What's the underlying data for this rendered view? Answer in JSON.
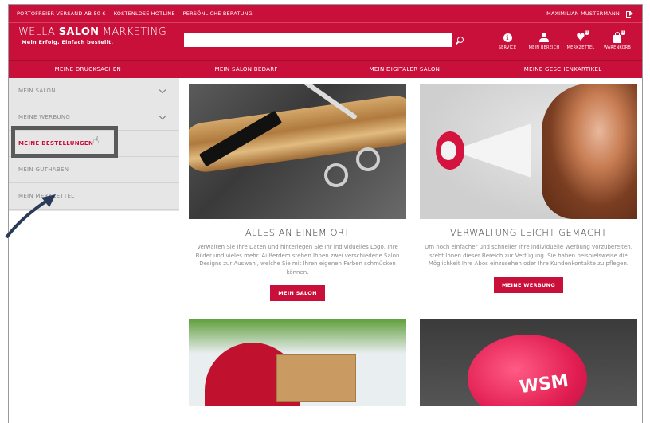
{
  "topbar": {
    "links": [
      "PORTOFREIER VERSAND AB 50 €",
      "KOSTENLOSE HOTLINE",
      "PERSÖNLICHE BERATUNG"
    ],
    "user": "MAXIMILIAN MUSTERMANN"
  },
  "header": {
    "logo_part1": "WELLA ",
    "logo_part2": "SALON",
    "logo_part3": " MARKETING",
    "logo_tagline": "Mein Erfolg. Einfach bestellt.",
    "search_placeholder": "",
    "icons": [
      {
        "label": "SERVICE",
        "icon": "info-icon"
      },
      {
        "label": "MEIN BEREICH",
        "icon": "user-icon"
      },
      {
        "label": "MERKZETTEL",
        "icon": "heart-icon",
        "badge": "0"
      },
      {
        "label": "WARENKORB",
        "icon": "bag-icon",
        "badge": "0"
      }
    ]
  },
  "nav": [
    "MEINE DRUCKSACHEN",
    "MEIN SALON BEDARF",
    "MEIN DIGITALER SALON",
    "MEINE GESCHENKARTIKEL"
  ],
  "sidebar": {
    "items": [
      {
        "label": "MEIN SALON",
        "chevron": true
      },
      {
        "label": "MEINE WERBUNG",
        "chevron": true
      },
      {
        "label": "MEINE BESTELLUNGEN",
        "active": true
      },
      {
        "label": "MEIN GUTHABEN"
      },
      {
        "label": "MEIN MERKZETTEL"
      }
    ]
  },
  "cards": [
    {
      "title": "ALLES AN EINEM ORT",
      "text": "Verwalten Sie Ihre Daten und hinterlegen Sie Ihr individuelles Logo, Ihre Bilder und vieles mehr. Außerdem stehen Ihnen zwei verschiedene Salon Designs zur Auswahl, welche Sie mit Ihren eigenen Farben schmücken können.",
      "button": "MEIN SALON"
    },
    {
      "title": "VERWALTUNG LEICHT GEMACHT",
      "text": "Um noch einfacher und schneller Ihre individuelle Werbung vorzubereiten, steht Ihnen dieser Bereich zur Verfügung. Sie haben beispielsweise die Möglichkeit Ihre Abos einzusehen oder Ihre Kundenkontakte zu pflegen.",
      "button": "MEINE WERBUNG"
    }
  ],
  "piggy_text": "WSM",
  "colors": {
    "brand": "#c8103b",
    "sidebar_bg": "#e6e6e6"
  }
}
